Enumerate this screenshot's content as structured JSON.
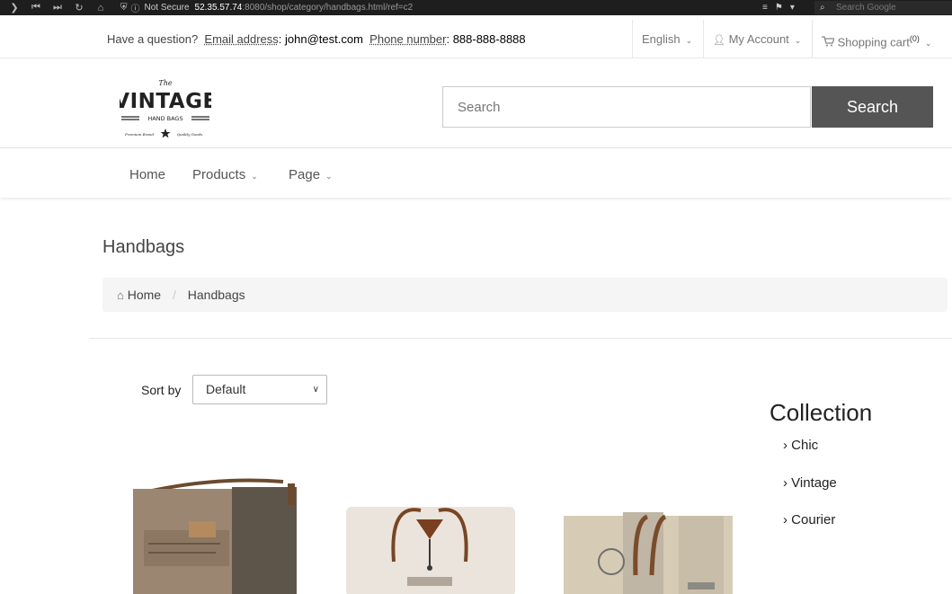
{
  "browser": {
    "security": "Not Secure",
    "url_host": "52.35.57.74",
    "url_path": ":8080/shop/category/handbags.html/ref=c2",
    "search_placeholder": "Search Google"
  },
  "topbar": {
    "question": "Have a question?",
    "email_label": "Email address",
    "email": "john@test.com",
    "phone_label": "Phone number",
    "phone": "888-888-8888",
    "language": "English",
    "account": "My Account",
    "cart": "Shopping cart",
    "cart_count": "(0)"
  },
  "header": {
    "logo_text": {
      "top": "The",
      "main": "VINTAGE",
      "sub": "HAND BAGS",
      "left": "Premium Brand",
      "right": "Quality Goods"
    },
    "search_placeholder": "Search",
    "search_button": "Search"
  },
  "nav": {
    "items": [
      {
        "label": "Home"
      },
      {
        "label": "Products"
      },
      {
        "label": "Page"
      }
    ]
  },
  "page": {
    "title": "Handbags",
    "breadcrumb": {
      "home": "Home",
      "current": "Handbags"
    }
  },
  "sort": {
    "label": "Sort by",
    "selected": "Default"
  },
  "collection": {
    "title": "Collection",
    "items": [
      "Chic",
      "Vintage",
      "Courier"
    ]
  }
}
